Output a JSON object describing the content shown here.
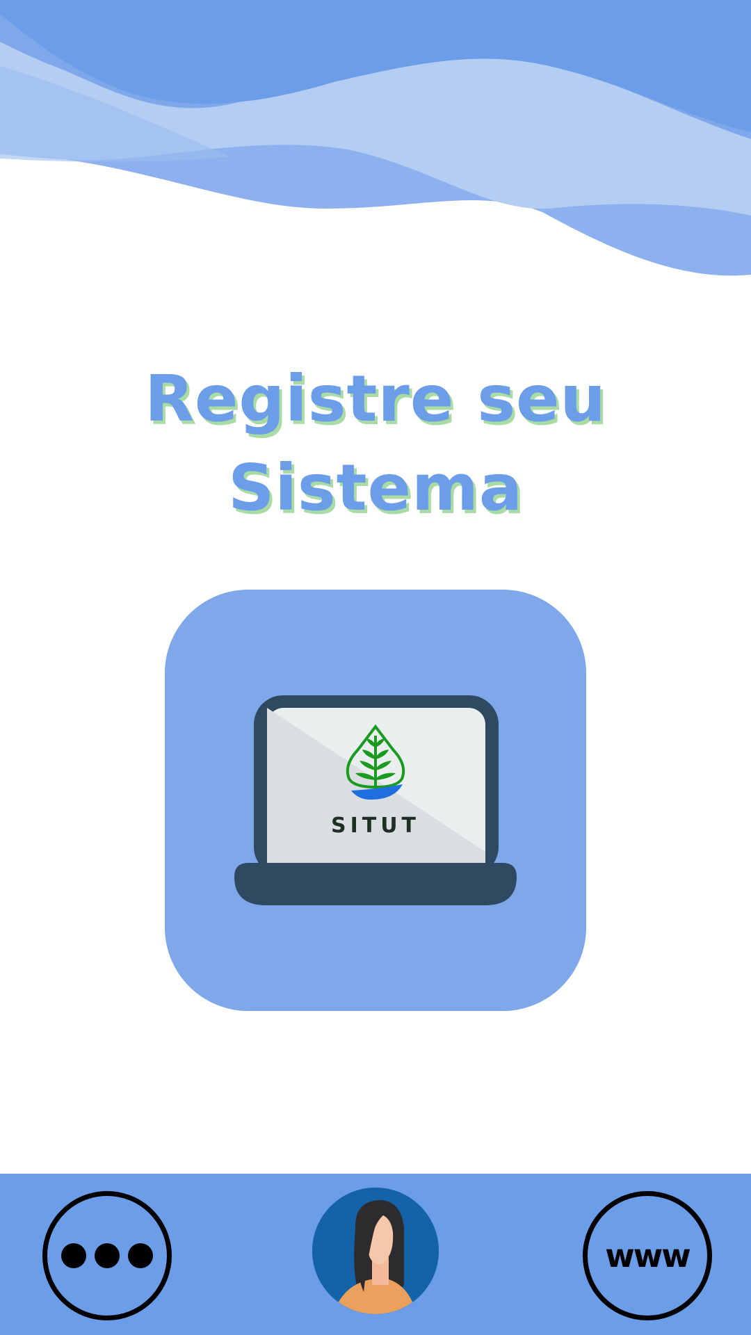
{
  "header": {
    "title_line1": "Registre seu",
    "title_line2": "Sistema"
  },
  "app_tile": {
    "logo_text": "SITUT",
    "icon": "laptop-icon",
    "logo_icon": "plant-leaf-icon"
  },
  "nav": {
    "more": {
      "icon": "more-dots-icon"
    },
    "profile": {
      "icon": "avatar-woman-icon"
    },
    "website": {
      "icon": "globe-www-icon",
      "label": "www"
    }
  },
  "colors": {
    "brand_blue": "#6b9de8",
    "tile_blue": "#7fa8ea",
    "title_shadow_green": "#a9dba4",
    "laptop_dark": "#2f4a60",
    "logo_green": "#1a9a1e",
    "avatar_bg": "#1462a8"
  }
}
